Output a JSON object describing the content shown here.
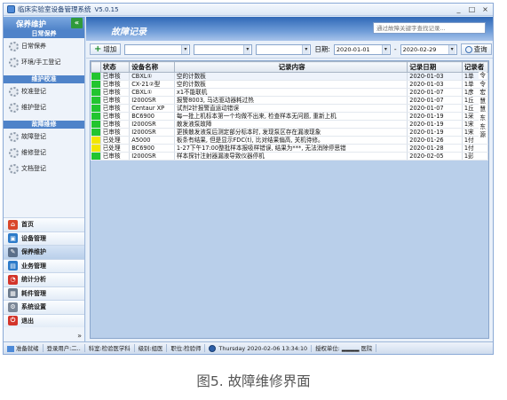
{
  "window": {
    "title": "临床实验室设备管理系统",
    "version": "V5.0.15",
    "controls": [
      "_",
      "□",
      "×"
    ]
  },
  "sidebar": {
    "header": "保养维护",
    "collapse_icon": "«",
    "groups": [
      {
        "title": "日常保养",
        "items": [
          "日常保养",
          "环境/手工登记"
        ]
      },
      {
        "title": "维护校准",
        "items": [
          "校准登记",
          "维护登记"
        ]
      },
      {
        "title": "故障维修",
        "items": [
          "故障登记",
          "维修登记",
          "文档登记"
        ]
      }
    ],
    "nav": [
      {
        "label": "首页",
        "icon": "home-icon",
        "color": "#d9472b"
      },
      {
        "label": "设备管理",
        "icon": "device-icon",
        "color": "#2d7bc9"
      },
      {
        "label": "保养维护",
        "icon": "maintenance-icon",
        "color": "#5b6f8a"
      },
      {
        "label": "业务管理",
        "icon": "business-icon",
        "color": "#2d7bc9"
      },
      {
        "label": "统计分析",
        "icon": "chart-icon",
        "color": "#d3342a"
      },
      {
        "label": "耗件管理",
        "icon": "parts-icon",
        "color": "#6b7a8c"
      },
      {
        "label": "系统设置",
        "icon": "settings-icon",
        "color": "#7b8797"
      },
      {
        "label": "退出",
        "icon": "exit-icon",
        "color": "#d3342a"
      }
    ],
    "more_icon": "»"
  },
  "main": {
    "title": "故障记录",
    "search_placeholder": "通过故障关键字查找记录...",
    "toolbar": {
      "add_label": "增加",
      "date_label": "日期:",
      "date_from": "2020-01-01",
      "date_sep": "-",
      "date_to": "2020-02-29",
      "query_label": "查询"
    },
    "table": {
      "columns": [
        "状态",
        "设备名称",
        "记录内容",
        "记录日期",
        "记录者"
      ],
      "rows": [
        {
          "mark": "green",
          "status": "已审核",
          "device": "CBXL①",
          "content": "空的计数板",
          "date": "2020-01-03",
          "recorder": "1单"
        },
        {
          "mark": "green",
          "status": "已审核",
          "device": "CX-21②型",
          "content": "空的计数板",
          "date": "2020-01-03",
          "recorder": "1单"
        },
        {
          "mark": "green",
          "status": "已审核",
          "device": "CBXL①",
          "content": "x1不能联机",
          "date": "2020-01-07",
          "recorder": "1彦"
        },
        {
          "mark": "green",
          "status": "已审核",
          "device": "I2000SR",
          "content": "报警8003, 马达驱动器耗过热",
          "date": "2020-01-07",
          "recorder": "1丘"
        },
        {
          "mark": "green",
          "status": "已审核",
          "device": "Centaur XP",
          "content": "试剂2针报警直运动错误",
          "date": "2020-01-07",
          "recorder": "1丘"
        },
        {
          "mark": "green",
          "status": "已审核",
          "device": "BC6900",
          "content": "每一批上机标本第一个均做不出来, 检查样本无问题, 重新上机",
          "date": "2020-01-19",
          "recorder": "1采"
        },
        {
          "mark": "green",
          "status": "已审核",
          "device": "I2000SR",
          "content": "散发液泵故障",
          "date": "2020-01-19",
          "recorder": "1宋"
        },
        {
          "mark": "green",
          "status": "已审核",
          "device": "I2000SR",
          "content": "更换散发液泵后测定部分标本时, 发现泵区存在漏液现象",
          "date": "2020-01-19",
          "recorder": "1宋"
        },
        {
          "mark": "yellow",
          "status": "已处理",
          "device": "A5000",
          "content": "板条有结果, 但是显示FDC(t), 比对结果偏高, 关机待修。",
          "date": "2020-01-26",
          "recorder": "1付"
        },
        {
          "mark": "yellow",
          "status": "已处理",
          "device": "BC6900",
          "content": "1-27下午17:00整批样本报吸样错误, 结果为***, 无法消除停思错",
          "date": "2020-01-28",
          "recorder": "1付"
        },
        {
          "mark": "green",
          "status": "已审核",
          "device": "I2000SR",
          "content": "样本探针注射器漏液导致仪器停机",
          "date": "2020-02-05",
          "recorder": "1彭"
        }
      ],
      "side_chars": [
        "令",
        "令",
        "宏",
        "慧",
        "慧",
        "东",
        "东",
        "源"
      ]
    }
  },
  "statusbar": {
    "ready": "准备就绪",
    "login_label": "登录用户:",
    "login_user": "二..",
    "dept": "科室:检验医学科",
    "level": "级别:组医",
    "position": "职位:检验师",
    "datetime": "Thursday 2020-02-06 13:34:10",
    "auth": "授权单位:",
    "hospital": "医院"
  },
  "caption": "图5. 故障维修界面"
}
